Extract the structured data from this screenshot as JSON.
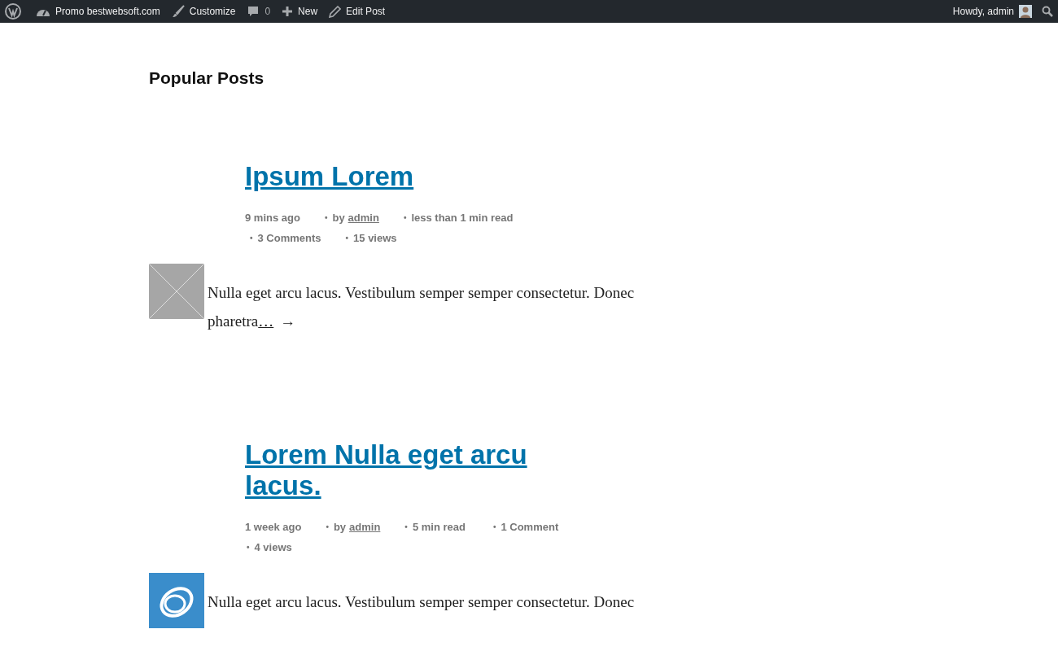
{
  "admin_bar": {
    "items": [
      {
        "kind": "logo"
      },
      {
        "kind": "dashboard",
        "label": "Promo bestwebsoft.com"
      },
      {
        "kind": "brush",
        "label": "Customize"
      },
      {
        "kind": "comment",
        "label": "0"
      },
      {
        "kind": "plus",
        "label": "New"
      },
      {
        "kind": "pencil",
        "label": "Edit Post"
      }
    ],
    "greeting": "Howdy, admin"
  },
  "widget_title": "Popular Posts",
  "posts": [
    {
      "title": "Ipsum Lorem",
      "meta": [
        {
          "text": "9 mins ago"
        },
        {
          "bullet": "•",
          "text": "by",
          "link": "admin"
        },
        {
          "bullet": "•",
          "text": "less than 1 min read"
        },
        {
          "bullet": "•",
          "text": "3 Comments"
        },
        {
          "bullet": "•",
          "text": "15 views"
        }
      ],
      "thumbnail": {
        "kind": "placeholder"
      },
      "excerpt": "Nulla eget arcu lacus. Vestibulum semper semper consectetur. Donec pharetra",
      "more": "…",
      "arrow": "→"
    },
    {
      "title": "Lorem Nulla eget arcu lacus.",
      "meta": [
        {
          "text": "1 week ago"
        },
        {
          "bullet": "•",
          "text": "by",
          "link": "admin"
        },
        {
          "bullet": "•",
          "text": "5 min read"
        },
        {
          "bullet": "•",
          "text": "1 Comment"
        },
        {
          "bullet": "•",
          "text": "4 views"
        }
      ],
      "thumbnail": {
        "kind": "logo"
      },
      "excerpt": "Nulla eget arcu lacus. Vestibulum semper semper consectetur. Donec"
    }
  ]
}
